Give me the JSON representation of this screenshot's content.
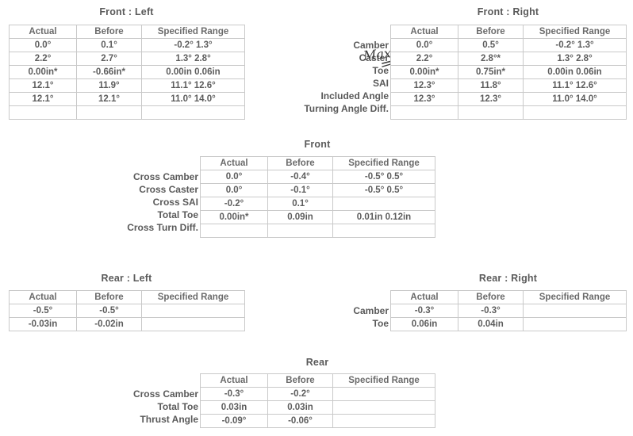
{
  "document": {
    "kind": "wheel-alignment-report"
  },
  "colors": {
    "green": "#3fcf92",
    "red": "#f4707a",
    "dark": "#555555",
    "border": "#c9c9c9"
  },
  "columns": {
    "actual": "Actual",
    "before": "Before",
    "specified_range": "Specified Range"
  },
  "front": {
    "left": {
      "title": "Front : Left",
      "headers": [
        "Actual",
        "Before",
        "Specified Range"
      ],
      "rows": [
        {
          "actual": "0.0°",
          "actual_state": "green",
          "before": "0.1°",
          "before_state": "green",
          "range": "-0.2° 1.3°"
        },
        {
          "actual": "2.2°",
          "actual_state": "green",
          "before": "2.7°",
          "before_state": "green",
          "range": "1.3° 2.8°"
        },
        {
          "actual": "0.00in*",
          "actual_state": "red",
          "before": "-0.66in*",
          "before_state": "red",
          "range": "0.00in 0.06in"
        },
        {
          "actual": "12.1°",
          "actual_state": "green",
          "before": "11.9°",
          "before_state": "green",
          "range": "11.1° 12.6°"
        },
        {
          "actual": "12.1°",
          "actual_state": "green",
          "before": "12.1°",
          "before_state": "green",
          "range": "11.0° 14.0°"
        },
        {
          "actual": "",
          "actual_state": "dark",
          "before": "",
          "before_state": "dark",
          "range": ""
        }
      ]
    },
    "labels": [
      "Camber",
      "Caster",
      "Toe",
      "SAI",
      "Included Angle",
      "Turning Angle Diff."
    ],
    "right": {
      "title": "Front : Right",
      "headers": [
        "Actual",
        "Before",
        "Specified Range"
      ],
      "rows": [
        {
          "actual": "0.0°",
          "actual_state": "green",
          "before": "0.5°",
          "before_state": "green",
          "range": "-0.2° 1.3°"
        },
        {
          "actual": "2.2°",
          "actual_state": "green",
          "before": "2.8°*",
          "before_state": "red",
          "range": "1.3° 2.8°"
        },
        {
          "actual": "0.00in*",
          "actual_state": "red",
          "before": "0.75in*",
          "before_state": "red",
          "range": "0.00in 0.06in"
        },
        {
          "actual": "12.3°",
          "actual_state": "green",
          "before": "11.8°",
          "before_state": "green",
          "range": "11.1° 12.6°"
        },
        {
          "actual": "12.3°",
          "actual_state": "green",
          "before": "12.3°",
          "before_state": "green",
          "range": "11.0° 14.0°"
        },
        {
          "actual": "",
          "actual_state": "dark",
          "before": "",
          "before_state": "dark",
          "range": ""
        }
      ]
    },
    "annotation": {
      "text": "Max",
      "target_row": "Caster"
    },
    "cross": {
      "title": "Front",
      "headers": [
        "Actual",
        "Before",
        "Specified Range"
      ],
      "labels": [
        "Cross Camber",
        "Cross Caster",
        "Cross SAI",
        "Total Toe",
        "Cross Turn Diff."
      ],
      "rows": [
        {
          "actual": "0.0°",
          "actual_state": "green",
          "before": "-0.4°",
          "before_state": "green",
          "range": "-0.5° 0.5°"
        },
        {
          "actual": "0.0°",
          "actual_state": "green",
          "before": "-0.1°",
          "before_state": "green",
          "range": "-0.5° 0.5°"
        },
        {
          "actual": "-0.2°",
          "actual_state": "dark",
          "before": "0.1°",
          "before_state": "dark",
          "range": ""
        },
        {
          "actual": "0.00in*",
          "actual_state": "red",
          "before": "0.09in",
          "before_state": "green",
          "range": "0.01in 0.12in"
        },
        {
          "actual": "",
          "actual_state": "dark",
          "before": "",
          "before_state": "dark",
          "range": ""
        }
      ]
    }
  },
  "rear": {
    "left": {
      "title": "Rear : Left",
      "headers": [
        "Actual",
        "Before",
        "Specified Range"
      ],
      "rows": [
        {
          "actual": "-0.5°",
          "actual_state": "dark",
          "before": "-0.5°",
          "before_state": "dark",
          "range": ""
        },
        {
          "actual": "-0.03in",
          "actual_state": "dark",
          "before": "-0.02in",
          "before_state": "dark",
          "range": ""
        }
      ]
    },
    "labels": [
      "Camber",
      "Toe"
    ],
    "right": {
      "title": "Rear : Right",
      "headers": [
        "Actual",
        "Before",
        "Specified Range"
      ],
      "rows": [
        {
          "actual": "-0.3°",
          "actual_state": "dark",
          "before": "-0.3°",
          "before_state": "dark",
          "range": ""
        },
        {
          "actual": "0.06in",
          "actual_state": "dark",
          "before": "0.04in",
          "before_state": "dark",
          "range": ""
        }
      ]
    },
    "cross": {
      "title": "Rear",
      "headers": [
        "Actual",
        "Before",
        "Specified Range"
      ],
      "labels": [
        "Cross Camber",
        "Total Toe",
        "Thrust Angle"
      ],
      "rows": [
        {
          "actual": "-0.3°",
          "actual_state": "dark",
          "before": "-0.2°",
          "before_state": "dark",
          "range": ""
        },
        {
          "actual": "0.03in",
          "actual_state": "dark",
          "before": "0.03in",
          "before_state": "dark",
          "range": ""
        },
        {
          "actual": "-0.09°",
          "actual_state": "dark",
          "before": "-0.06°",
          "before_state": "dark",
          "range": ""
        }
      ]
    }
  }
}
